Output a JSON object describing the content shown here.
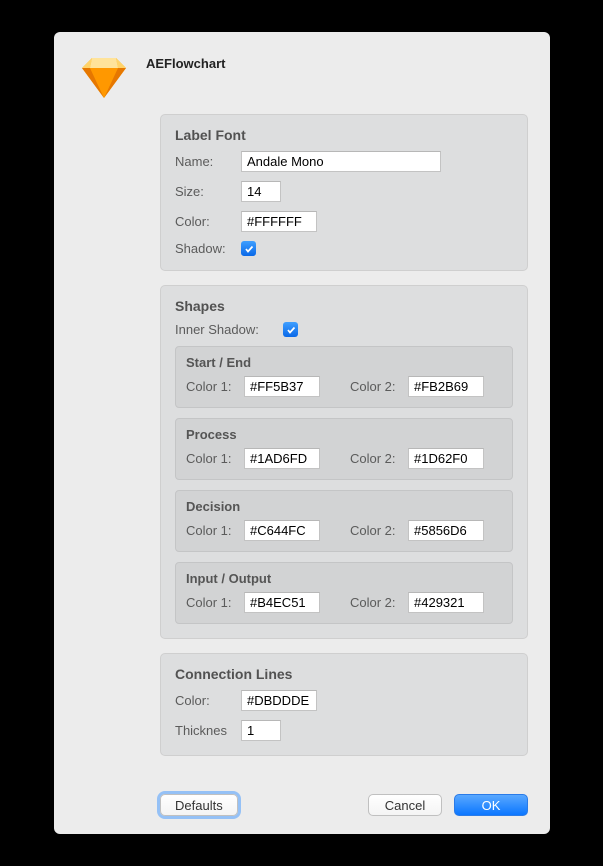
{
  "app": {
    "title": "AEFlowchart"
  },
  "labelFont": {
    "title": "Label Font",
    "nameLabel": "Name:",
    "nameValue": "Andale Mono",
    "sizeLabel": "Size:",
    "sizeValue": "14",
    "colorLabel": "Color:",
    "colorValue": "#FFFFFF",
    "shadowLabel": "Shadow:",
    "shadowChecked": true
  },
  "shapes": {
    "title": "Shapes",
    "innerShadowLabel": "Inner Shadow:",
    "innerShadowChecked": true,
    "color1Label": "Color 1:",
    "color2Label": "Color 2:",
    "items": [
      {
        "title": "Start / End",
        "c1": "#FF5B37",
        "c2": "#FB2B69"
      },
      {
        "title": "Process",
        "c1": "#1AD6FD",
        "c2": "#1D62F0"
      },
      {
        "title": "Decision",
        "c1": "#C644FC",
        "c2": "#5856D6"
      },
      {
        "title": "Input / Output",
        "c1": "#B4EC51",
        "c2": "#429321"
      }
    ]
  },
  "conn": {
    "title": "Connection Lines",
    "colorLabel": "Color:",
    "colorValue": "#DBDDDE",
    "thickLabel": "Thicknes",
    "thickValue": "1"
  },
  "buttons": {
    "defaults": "Defaults",
    "cancel": "Cancel",
    "ok": "OK"
  }
}
